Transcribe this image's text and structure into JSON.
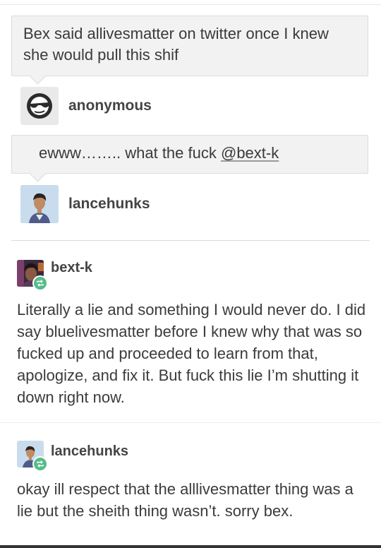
{
  "thread": {
    "original_ask": {
      "text": "Bex said allivesmatter on twitter once I knew she would pull this shif",
      "author": "anonymous",
      "author_icon": "sunglasses-face-icon"
    },
    "reply_ask": {
      "text_before": "ewww…….. what the fuck ",
      "mention": "@bext-k",
      "author": "lancehunks"
    }
  },
  "posts": [
    {
      "username": "bext-k",
      "badge_icon": "reblog-icon",
      "body": "Literally a lie and something I would never do. I did say bluelivesmatter before I knew why that was so fucked up and proceeded to learn from that, apologize, and fix it. But fuck this lie I’m shutting it down right now."
    },
    {
      "username": "lancehunks",
      "badge_icon": "reblog-icon",
      "body": "okay ill respect that the alllivesmatter thing was a lie but the sheith thing wasn’t. sorry bex."
    }
  ],
  "colors": {
    "bubble_bg": "#f2f2f2",
    "reblog_badge": "#56bc8a",
    "text": "#3b3b3b"
  }
}
